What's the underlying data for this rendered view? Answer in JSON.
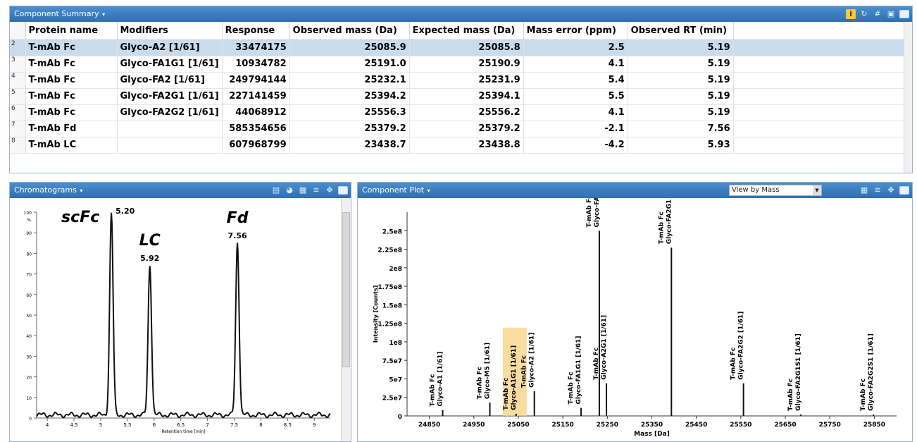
{
  "summary": {
    "title": "Component Summary",
    "columns": [
      "Protein name",
      "Modifiers",
      "Response",
      "Observed mass (Da)",
      "Expected mass (Da)",
      "Mass error (ppm)",
      "Observed RT (min)"
    ],
    "rows": [
      {
        "n": "2",
        "protein": "T-mAb Fc",
        "mod": "Glyco-A2 [1/61]",
        "resp": "33474175",
        "obs": "25085.9",
        "exp": "25085.8",
        "err": "2.5",
        "rt": "5.19"
      },
      {
        "n": "3",
        "protein": "T-mAb Fc",
        "mod": "Glyco-FA1G1 [1/61]",
        "resp": "10934782",
        "obs": "25191.0",
        "exp": "25190.9",
        "err": "4.1",
        "rt": "5.19"
      },
      {
        "n": "4",
        "protein": "T-mAb Fc",
        "mod": "Glyco-FA2 [1/61]",
        "resp": "249794144",
        "obs": "25232.1",
        "exp": "25231.9",
        "err": "5.4",
        "rt": "5.19"
      },
      {
        "n": "5",
        "protein": "T-mAb Fc",
        "mod": "Glyco-FA2G1 [1/61]",
        "resp": "227141459",
        "obs": "25394.2",
        "exp": "25394.1",
        "err": "5.5",
        "rt": "5.19"
      },
      {
        "n": "6",
        "protein": "T-mAb Fc",
        "mod": "Glyco-FA2G2 [1/61]",
        "resp": "44068912",
        "obs": "25556.3",
        "exp": "25556.2",
        "err": "4.1",
        "rt": "5.19"
      },
      {
        "n": "7",
        "protein": "T-mAb Fd",
        "mod": "",
        "resp": "585354656",
        "obs": "25379.2",
        "exp": "25379.2",
        "err": "-2.1",
        "rt": "7.56"
      },
      {
        "n": "8",
        "protein": "T-mAb LC",
        "mod": "",
        "resp": "607968799",
        "obs": "23438.7",
        "exp": "23438.8",
        "err": "-4.2",
        "rt": "5.93"
      }
    ]
  },
  "chrom": {
    "title": "Chromatograms",
    "xlabel": "Retention time [min]",
    "xticks": [
      "4",
      "4.5",
      "5",
      "5.5",
      "6",
      "6.5",
      "7",
      "7.5",
      "8",
      "8.5",
      "9"
    ],
    "yticks": [
      "0",
      "10",
      "20",
      "30",
      "40",
      "50",
      "60",
      "70",
      "80",
      "90",
      "100"
    ],
    "ytop_unit": "%",
    "peaks": [
      {
        "rt": 5.2,
        "h": 100,
        "label": "5.20",
        "name": "scFc"
      },
      {
        "rt": 5.92,
        "h": 75,
        "label": "5.92",
        "name": "LC"
      },
      {
        "rt": 7.56,
        "h": 86,
        "label": "7.56",
        "name": "Fd"
      }
    ]
  },
  "plot": {
    "title": "Component Plot",
    "view": "View by Mass",
    "xlabel": "Mass [Da]",
    "ylabel": "Intensity [Counts]",
    "xticks": [
      "24850",
      "24950",
      "25050",
      "25150",
      "25250",
      "25350",
      "25450",
      "25550",
      "25650",
      "25750",
      "25850"
    ],
    "yticks": [
      "0",
      "2.5e7",
      "5e7",
      "7.5e7",
      "1e8",
      "1.25e8",
      "1.5e8",
      "1.75e8",
      "2e8",
      "2.25e8",
      "2.5e8"
    ]
  },
  "chart_data": [
    {
      "type": "line",
      "title": "",
      "xlabel": "Retention time [min]",
      "ylabel": "",
      "xlim": [
        3.8,
        9.3
      ],
      "ylim": [
        0,
        100
      ],
      "series": [
        {
          "x": [
            3.8,
            4.5,
            5.0,
            5.1,
            5.2,
            5.3,
            5.4,
            5.8,
            5.92,
            6.05,
            6.5,
            7.2,
            7.45,
            7.56,
            7.7,
            8.0,
            8.5,
            9.3
          ],
          "y": [
            1,
            1,
            2,
            30,
            100,
            30,
            5,
            3,
            75,
            5,
            2,
            2,
            25,
            86,
            12,
            3,
            2,
            1
          ]
        }
      ]
    },
    {
      "type": "bar",
      "title": "",
      "xlabel": "Mass [Da]",
      "ylabel": "Intensity [Counts]",
      "ylim": [
        0,
        275000000
      ],
      "categories": [
        "T-mAb Fc Glyco-A1 [1/61]",
        "T-mAb Fc Glyco-M5 [1/61]",
        "T-mAb Fc Glyco-A1G1 [1/61]",
        "T-mAb Fc Glyco-A2 [1/61]",
        "T-mAb Fc Glyco-FA1G1 [1/61]",
        "T-mAb Fc Glyco-FA2 [1/61]",
        "T-mAb Fc Glyco-A2G1 [1/61]",
        "T-mAb Fc Glyco-FA2G1 [1/61]",
        "T-mAb Fc Glyco-FA2G2 [1/61]",
        "T-mAb Fc Glyco-FA2G1S1 [1/61]",
        "T-mAb Fc Glyco-FA2G2S1 [1/61]"
      ],
      "x": [
        24880,
        24986,
        25045,
        25086,
        25191,
        25232,
        25248,
        25394,
        25556,
        25685,
        25848
      ],
      "values": [
        8000000,
        18000000,
        3000000,
        33474175,
        10934782,
        249794144,
        44000000,
        227141459,
        44068912,
        2000000,
        2000000
      ]
    }
  ]
}
